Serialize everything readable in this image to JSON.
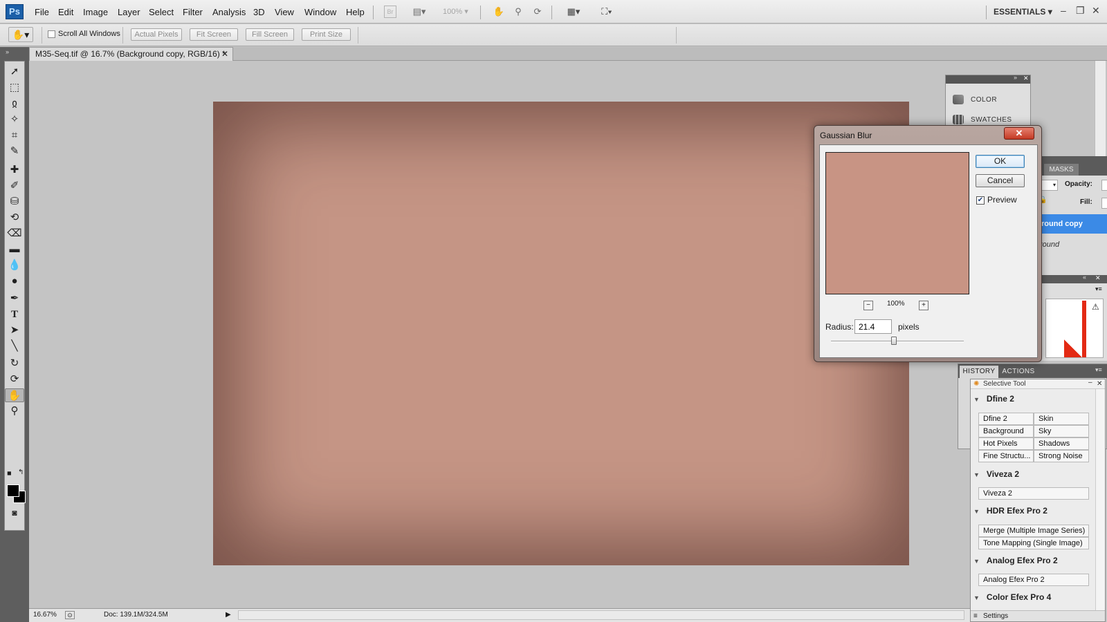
{
  "app": {
    "logo": "Ps",
    "menu": [
      "File",
      "Edit",
      "Image",
      "Layer",
      "Select",
      "Filter",
      "Analysis",
      "3D",
      "View",
      "Window",
      "Help"
    ],
    "bridge_label": "Br",
    "zoom_display": "100%",
    "workspace": "ESSENTIALS",
    "window_controls": {
      "minimize": "–",
      "restore": "❐",
      "close": "✕"
    }
  },
  "options_bar": {
    "scroll_all_windows_label": "Scroll All Windows",
    "scroll_all_windows_checked": false,
    "buttons": [
      "Actual Pixels",
      "Fit Screen",
      "Fill Screen",
      "Print Size"
    ]
  },
  "document": {
    "tab_title": "M35-Seq.tif @ 16.7% (Background copy, RGB/16) *",
    "close_glyph": "✕",
    "canvas_color": "#c59585"
  },
  "toolbox": {
    "tools": [
      "move-tool-icon",
      "marquee-tool-icon",
      "lasso-tool-icon",
      "magic-wand-icon",
      "crop-tool-icon",
      "eyedropper-icon",
      "healing-brush-icon",
      "brush-tool-icon",
      "clone-stamp-icon",
      "history-brush-icon",
      "eraser-icon",
      "gradient-tool-icon",
      "blur-tool-icon",
      "dodge-tool-icon",
      "pen-tool-icon",
      "type-tool-icon",
      "path-selection-icon",
      "line-tool-icon",
      "3d-rotate-icon",
      "3d-orbit-icon",
      "hand-tool-icon",
      "zoom-tool-icon"
    ],
    "type_glyph": "T",
    "foreground_color": "#000000",
    "background_color": "#000000"
  },
  "status_bar": {
    "zoom": "16.67%",
    "doc_info": "Doc: 139.1M/324.5M"
  },
  "dock": {
    "color_label": "COLOR",
    "swatches_label": "SWATCHES"
  },
  "layers_panel": {
    "masks_tab": "MASKS",
    "opacity_label": "Opacity:",
    "fill_label": "Fill:",
    "selected_layer": "round copy",
    "background_layer": "round"
  },
  "history_panel": {
    "tabs": [
      "HISTORY",
      "ACTIONS"
    ]
  },
  "selective_tool": {
    "title": "Selective Tool",
    "groups": [
      {
        "name": "Dfine 2",
        "items": [
          "Dfine 2",
          "Skin",
          "Background",
          "Sky",
          "Hot Pixels",
          "Shadows",
          "Fine Structu...",
          "Strong Noise"
        ]
      },
      {
        "name": "Viveza 2",
        "items": [
          "Viveza 2"
        ]
      },
      {
        "name": "HDR Efex Pro 2",
        "items": [
          "Merge (Multiple Image Series)",
          "Tone Mapping (Single Image)"
        ]
      },
      {
        "name": "Analog Efex Pro 2",
        "items": [
          "Analog Efex Pro 2"
        ]
      },
      {
        "name": "Color Efex Pro 4",
        "items": []
      }
    ],
    "settings_label": "Settings"
  },
  "dialog": {
    "title": "Gaussian Blur",
    "ok": "OK",
    "cancel": "Cancel",
    "preview_label": "Preview",
    "preview_checked": true,
    "preview_zoom": "100%",
    "zoom_out": "−",
    "zoom_in": "+",
    "radius_label": "Radius:",
    "radius_value": "21.4",
    "radius_unit": "pixels",
    "preview_color": "#c89484"
  }
}
